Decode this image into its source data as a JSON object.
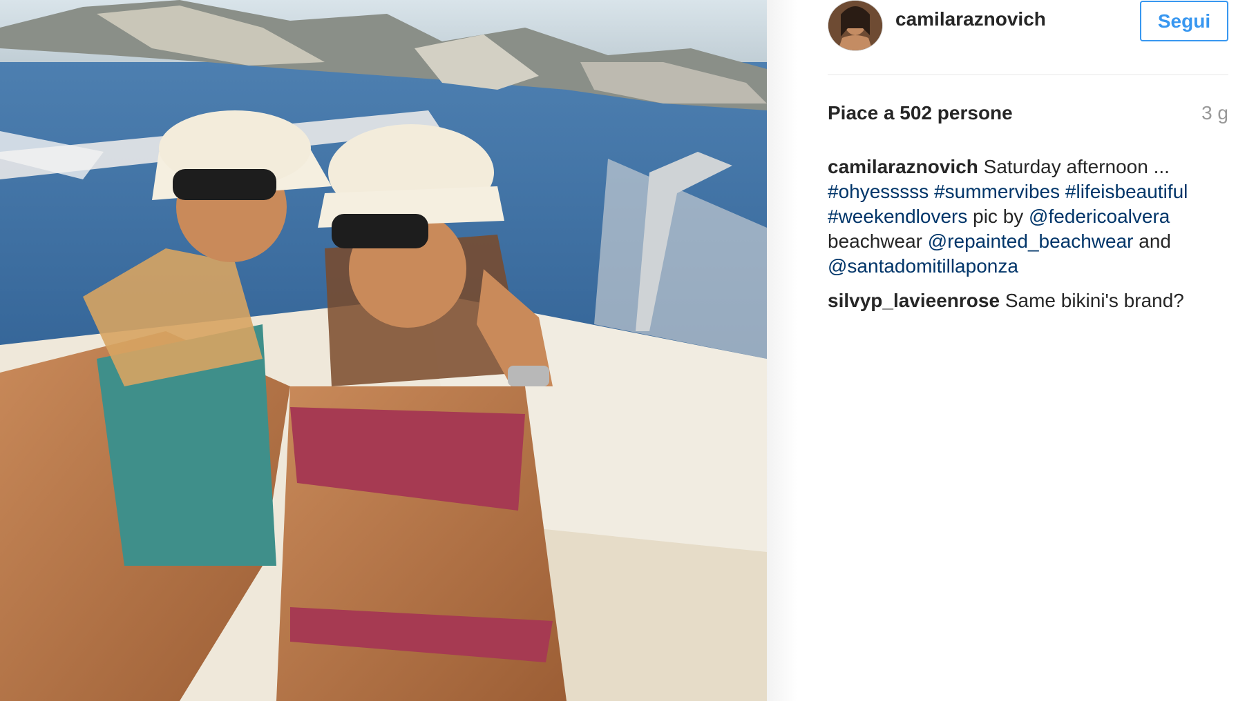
{
  "post": {
    "username": "camilaraznovich",
    "follow_label": "Segui",
    "likes": "Piace a 502 persone",
    "age": "3 g",
    "caption": {
      "username": "camilaraznovich",
      "text_1": " Saturday afternoon ...",
      "tag_1": "#ohyesssss",
      "tag_2": "#summervibes",
      "tag_3": "#lifeisbeautiful",
      "tag_4": "#weekendlovers",
      "text_2": " pic by ",
      "mention_1": "@federicoalvera",
      "text_3": "beachwear ",
      "mention_2": "@repainted_beachwear",
      "text_4": " and",
      "mention_3": "@santadomitillaponza"
    },
    "comment": {
      "username": "silvyp_lavieenrose",
      "text": " Same bikini's brand?"
    }
  },
  "colors": {
    "link": "#003569",
    "follow": "#3897f0",
    "meta": "#999999",
    "text": "#262626"
  },
  "icons": {
    "avatar": "profile-photo"
  }
}
